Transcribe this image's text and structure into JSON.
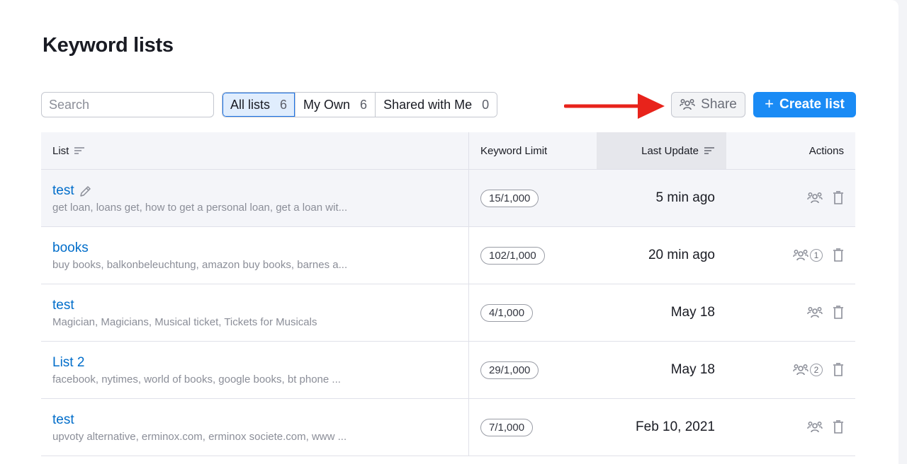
{
  "page": {
    "title": "Keyword lists"
  },
  "search": {
    "placeholder": "Search"
  },
  "tabs": [
    {
      "label": "All lists",
      "count": "6",
      "active": true
    },
    {
      "label": "My Own",
      "count": "6",
      "active": false
    },
    {
      "label": "Shared with Me",
      "count": "0",
      "active": false
    }
  ],
  "toolbar": {
    "share_label": "Share",
    "create_label": "Create list"
  },
  "table": {
    "headers": {
      "list": "List",
      "limit": "Keyword Limit",
      "updated": "Last Update",
      "actions": "Actions"
    },
    "rows": [
      {
        "name": "test",
        "keywords": "get loan, loans get, how to get a personal loan, get a loan wit...",
        "limit": "15/1,000",
        "updated": "5 min ago",
        "shared_count": ""
      },
      {
        "name": "books",
        "keywords": "buy books, balkonbeleuchtung, amazon buy books, barnes a...",
        "limit": "102/1,000",
        "updated": "20 min ago",
        "shared_count": "1"
      },
      {
        "name": "test",
        "keywords": "Magician, Magicians, Musical ticket, Tickets for Musicals",
        "limit": "4/1,000",
        "updated": "May 18",
        "shared_count": ""
      },
      {
        "name": "List 2",
        "keywords": "facebook, nytimes, world of books, google books, bt phone ...",
        "limit": "29/1,000",
        "updated": "May 18",
        "shared_count": "2"
      },
      {
        "name": "test",
        "keywords": "upvoty alternative, erminox.com, erminox societe.com, www ...",
        "limit": "7/1,000",
        "updated": "Feb 10, 2021",
        "shared_count": ""
      }
    ]
  },
  "colors": {
    "accent": "#1a8bf5",
    "link": "#006dca",
    "arrow": "#e8231b"
  }
}
